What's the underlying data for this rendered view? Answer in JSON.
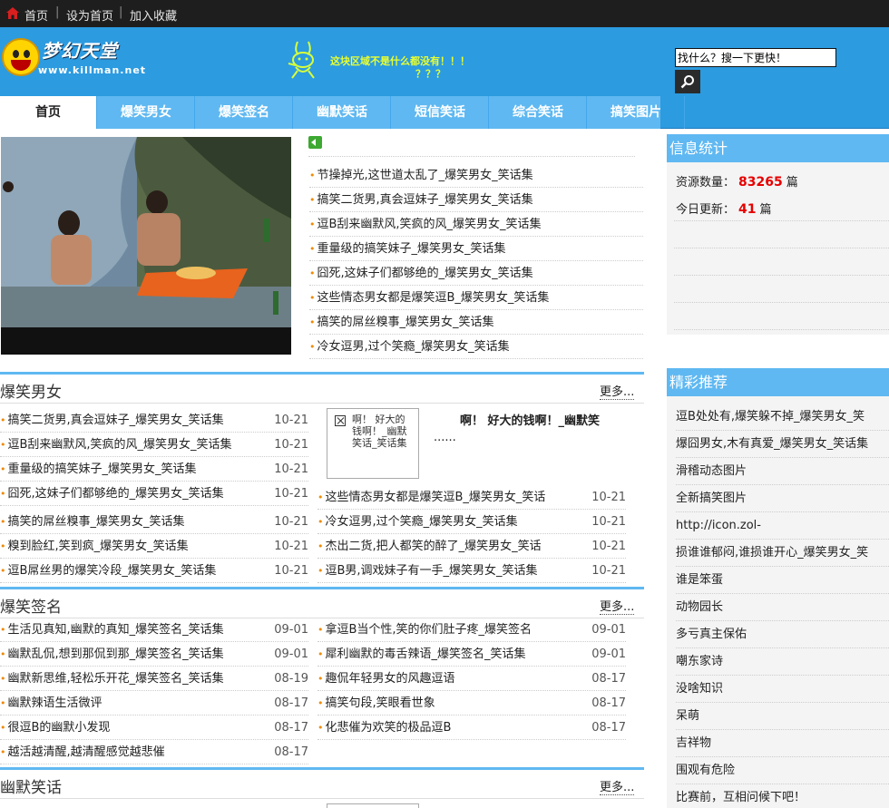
{
  "topbar": {
    "home": "首页",
    "set_home": "设为首页",
    "bookmark": "加入收藏",
    "sep": "|"
  },
  "header": {
    "logo_text": "梦幻天堂",
    "logo_url": "www.killman.net",
    "banner_line1": "这块区域不是什么都没有！！！",
    "banner_line2": "？？？",
    "search_value": "找什么？搜一下更快！"
  },
  "nav": {
    "tabs": [
      "首页",
      "爆笑男女",
      "爆笑签名",
      "幽默笑话",
      "短信笑话",
      "综合笑话",
      "搞笑图片"
    ],
    "active": 0
  },
  "headlines": [
    "节操掉光,这世道太乱了_爆笑男女_笑话集",
    "搞笑二货男,真会逗妹子_爆笑男女_笑话集",
    "逗B刮来幽默风,笑疯的风_爆笑男女_笑话集",
    "重量级的搞笑妹子_爆笑男女_笑话集",
    "囧死,这妹子们都够绝的_爆笑男女_笑话集",
    "这些情态男女都是爆笑逗B_爆笑男女_笑话集",
    "搞笑的屌丝糗事_爆笑男女_笑话集",
    "冷女逗男,过个笑瘾_爆笑男女_笑话集"
  ],
  "section1": {
    "title": "爆笑男女",
    "more": "更多...",
    "left_rows": [
      {
        "text": "搞笑二货男,真会逗妹子_爆笑男女_笑话集",
        "date": "10-21"
      },
      {
        "text": "逗B刮来幽默风,笑疯的风_爆笑男女_笑话集",
        "date": "10-21"
      },
      {
        "text": "重量级的搞笑妹子_爆笑男女_笑话集",
        "date": "10-21"
      },
      {
        "text": "囧死,这妹子们都够绝的_爆笑男女_笑话集",
        "date": "10-21"
      },
      {
        "text": "搞笑的屌丝糗事_爆笑男女_笑话集",
        "date": "10-21"
      },
      {
        "text": "糗到脸红,笑到疯_爆笑男女_笑话集",
        "date": "10-21"
      },
      {
        "text": "逗B屌丝男的爆笑冷段_爆笑男女_笑话集",
        "date": "10-21"
      }
    ],
    "feature_alt": "啊！ 好大的钱啊！_幽默笑话_笑话集",
    "feature_title": "啊！ 好大的钱啊！_幽默笑",
    "feature_ellipsis": "......",
    "right_rows": [
      {
        "text": "这些情态男女都是爆笑逗B_爆笑男女_笑话",
        "date": "10-21"
      },
      {
        "text": "冷女逗男,过个笑瘾_爆笑男女_笑话集",
        "date": "10-21"
      },
      {
        "text": "杰出二货,把人都笑的醉了_爆笑男女_笑话",
        "date": "10-21"
      },
      {
        "text": "逗B男,调戏妹子有一手_爆笑男女_笑话集",
        "date": "10-21"
      }
    ]
  },
  "section2": {
    "title": "爆笑签名",
    "more": "更多...",
    "left_rows": [
      {
        "text": "生活见真知,幽默的真知_爆笑签名_笑话集",
        "date": "09-01"
      },
      {
        "text": "幽默乱侃,想到那侃到那_爆笑签名_笑话集",
        "date": "09-01"
      },
      {
        "text": "幽默新思维,轻松乐开花_爆笑签名_笑话集",
        "date": "08-19"
      },
      {
        "text": "幽默辣语生活微评",
        "date": "08-17"
      },
      {
        "text": "很逗B的幽默小发现",
        "date": "08-17"
      },
      {
        "text": "越活越清醒,越清醒感觉越悲催",
        "date": "08-17"
      }
    ],
    "right_rows": [
      {
        "text": "拿逗B当个性,笑的你们肚子疼_爆笑签名",
        "date": "09-01"
      },
      {
        "text": "犀利幽默的毒舌辣语_爆笑签名_笑话集",
        "date": "09-01"
      },
      {
        "text": "趣侃年轻男女的风趣逗语",
        "date": "08-17"
      },
      {
        "text": "搞笑句段,笑眼看世象",
        "date": "08-17"
      },
      {
        "text": "化悲催为欢笑的极品逗B",
        "date": "08-17"
      }
    ]
  },
  "section3": {
    "title": "幽默笑话",
    "more": "更多..."
  },
  "sidebar": {
    "stats_title": "信息统计",
    "resource_label": "资源数量：",
    "resource_count": "83265",
    "today_label": "今日更新：",
    "today_count": "41",
    "unit": "篇",
    "rec_title": "精彩推荐",
    "rec_items": [
      "逗B处处有,爆笑躲不掉_爆笑男女_笑",
      "爆囧男女,木有真爱_爆笑男女_笑话集",
      "滑稽动态图片",
      "全新搞笑图片",
      "http://icon.zol-",
      "损谁谁郁闷,谁损谁开心_爆笑男女_笑",
      "谁是笨蛋",
      "动物园长",
      "多亏真主保佑",
      "嘲东家诗",
      "没啥知识",
      "呆萌",
      "吉祥物",
      "围观有危险",
      "比赛前，互相问候下吧！"
    ]
  },
  "colors": {
    "header": "#2c9be0",
    "nav": "#5fb8f1",
    "accent": "#f08a00",
    "highlight": "#e60000"
  }
}
